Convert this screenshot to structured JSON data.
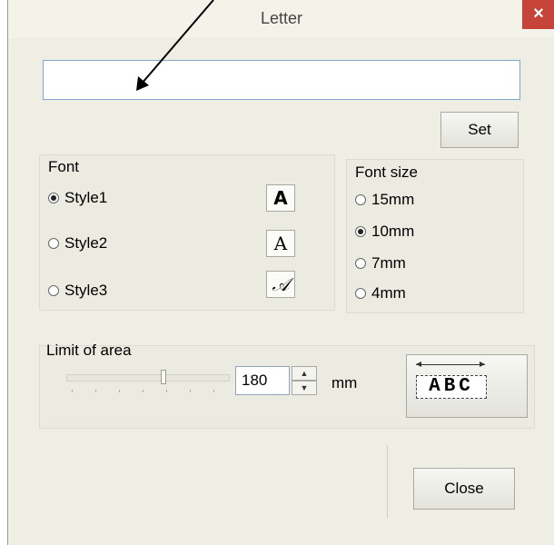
{
  "window": {
    "title": "Letter",
    "close_glyph": "×"
  },
  "text_input": {
    "value": ""
  },
  "set_button": {
    "label": "Set"
  },
  "font_group": {
    "label": "Font",
    "options": [
      {
        "label": "Style1",
        "selected": true,
        "icon_glyph": "A"
      },
      {
        "label": "Style2",
        "selected": false,
        "icon_glyph": "A"
      },
      {
        "label": "Style3",
        "selected": false,
        "icon_glyph": "𝒜"
      }
    ]
  },
  "font_size_group": {
    "label": "Font size",
    "options": [
      {
        "label": "15mm",
        "selected": false
      },
      {
        "label": "10mm",
        "selected": true
      },
      {
        "label": "7mm",
        "selected": false
      },
      {
        "label": "4mm",
        "selected": false
      }
    ]
  },
  "limit_group": {
    "label": "Limit of area",
    "value": "180",
    "unit": "mm",
    "preview_text": "ABC"
  },
  "close_button": {
    "label": "Close"
  },
  "colors": {
    "dialog_bg": "#efeee4",
    "close_red": "#c64339",
    "input_border": "#7fa7c9"
  }
}
